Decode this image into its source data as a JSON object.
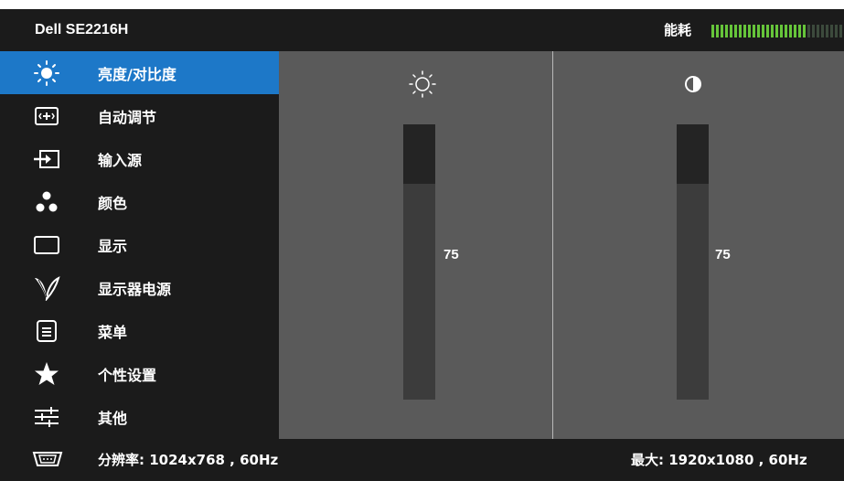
{
  "header": {
    "model": "Dell SE2216H",
    "energy_label": "能耗",
    "energy_level": 0.72
  },
  "menu": [
    {
      "label": "亮度/对比度",
      "icon": "brightness-icon",
      "selected": true
    },
    {
      "label": "自动调节",
      "icon": "auto-adjust-icon",
      "selected": false
    },
    {
      "label": "输入源",
      "icon": "input-source-icon",
      "selected": false
    },
    {
      "label": "颜色",
      "icon": "color-icon",
      "selected": false
    },
    {
      "label": "显示",
      "icon": "display-icon",
      "selected": false
    },
    {
      "label": "显示器电源",
      "icon": "energy-leaf-icon",
      "selected": false
    },
    {
      "label": "菜单",
      "icon": "menu-icon",
      "selected": false
    },
    {
      "label": "个性设置",
      "icon": "star-icon",
      "selected": false
    },
    {
      "label": "其他",
      "icon": "sliders-icon",
      "selected": false
    }
  ],
  "brightness": {
    "value": "75",
    "icon": "brightness-icon"
  },
  "contrast": {
    "value": "75",
    "icon": "contrast-icon"
  },
  "footer": {
    "current_resolution": "分辨率: 1024x768 , 60Hz",
    "max_resolution": "最大: 1920x1080 , 60Hz",
    "icon": "vga-connector-icon"
  },
  "colors": {
    "accent": "#1d78c8",
    "background": "#1b1b1b",
    "panel": "#5a5a5a",
    "energy_on": "#66c53a"
  }
}
